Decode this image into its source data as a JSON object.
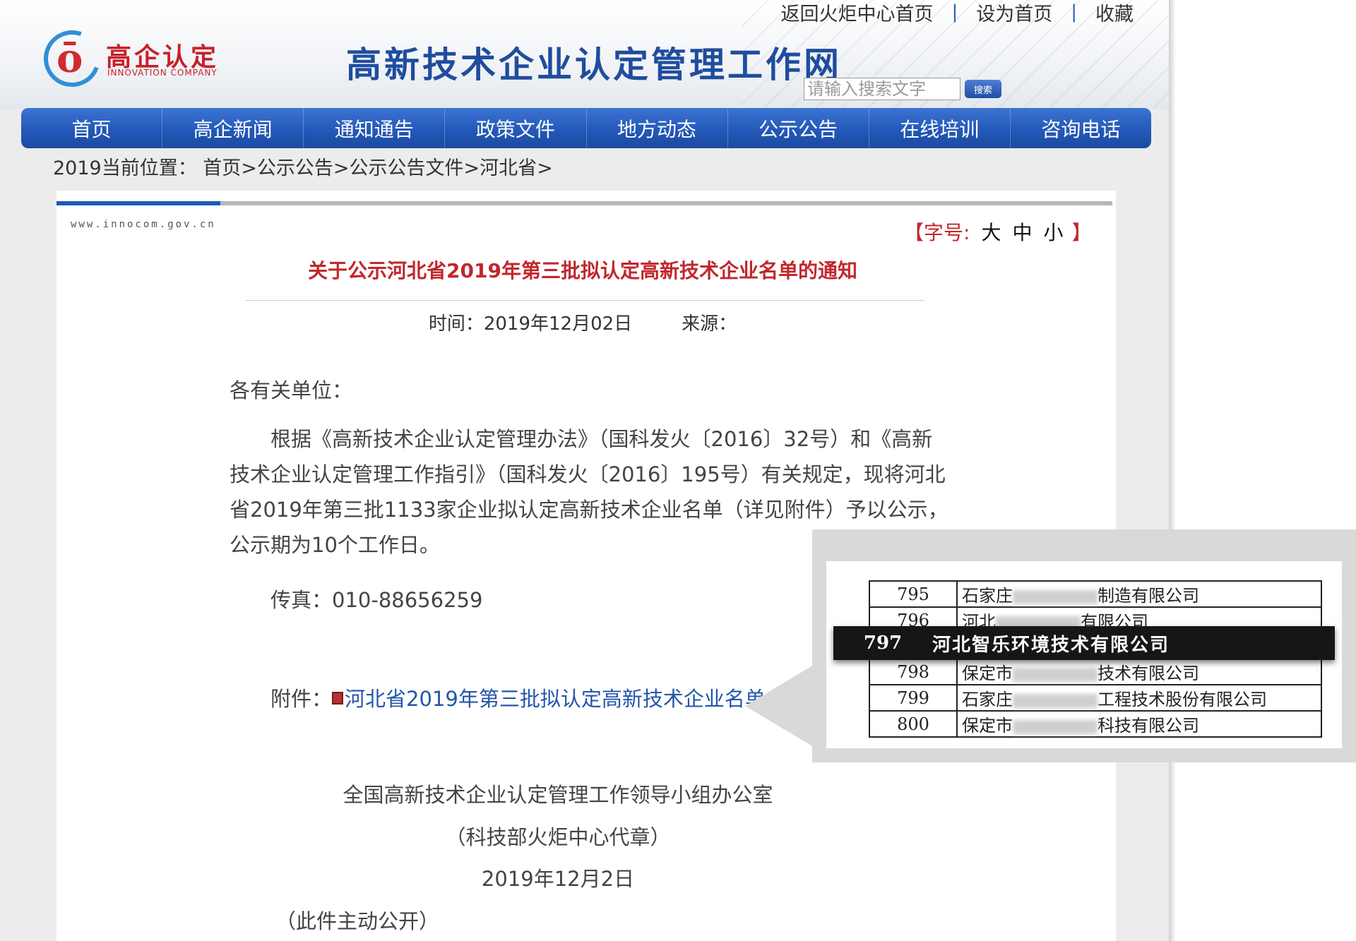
{
  "top_links": {
    "back_home": "返回火炬中心首页",
    "set_home": "设为首页",
    "favorite": "收藏",
    "separator": "|"
  },
  "logo": {
    "cn": "高企认定",
    "en": "INNOVATION COMPANY"
  },
  "site_title": "高新技术企业认定管理工作网",
  "search": {
    "placeholder": "请输入搜索文字",
    "button": "搜索"
  },
  "nav": [
    "首页",
    "高企新闻",
    "通知通告",
    "政策文件",
    "地方动态",
    "公示公告",
    "在线培训",
    "咨询电话"
  ],
  "breadcrumb": "2019当前位置： 首页>公示公告>公示公告文件>河北省>",
  "domain_text": "www.innocom.gov.cn",
  "font_size": {
    "label": "【字号:",
    "large": "大",
    "medium": "中",
    "small": "小",
    "close": "】"
  },
  "article": {
    "title": "关于公示河北省2019年第三批拟认定高新技术企业名单的通知",
    "time_label": "时间：",
    "time": "2019年12月02日",
    "source_label": "来源：",
    "greeting": "各有关单位：",
    "body": "根据《高新技术企业认定管理办法》（国科发火〔2016〕32号）和《高新技术企业认定管理工作指引》（国科发火〔2016〕195号）有关规定，现将河北省2019年第三批1133家企业拟认定高新技术企业名单（详见附件）予以公示，公示期为10个工作日。",
    "fax": "传真：010-88656259",
    "attachment_label": "附件：",
    "attachment_link": "河北省2019年第三批拟认定高新技术企业名单",
    "signature_org": "全国高新技术企业认定管理工作领导小组办公室",
    "signature_note": "（科技部火炬中心代章）",
    "signature_date": "2019年12月2日",
    "disclosure": "（此件主动公开）"
  },
  "zoom_table": {
    "rows": [
      {
        "num": "795",
        "prefix": "石家庄",
        "suffix": "制造有限公司"
      },
      {
        "num": "796",
        "prefix": "河北",
        "suffix": "有限公司"
      },
      {
        "num": "798",
        "prefix": "保定市",
        "suffix": "技术有限公司"
      },
      {
        "num": "799",
        "prefix": "石家庄",
        "suffix": "工程技术股份有限公司"
      },
      {
        "num": "800",
        "prefix": "保定市",
        "suffix": "科技有限公司"
      }
    ],
    "highlight": {
      "num": "797",
      "name": "河北智乐环境技术有限公司"
    }
  },
  "colors": {
    "nav": "#2459b9",
    "title_red": "#c1272d",
    "link_blue": "#2356a8"
  }
}
